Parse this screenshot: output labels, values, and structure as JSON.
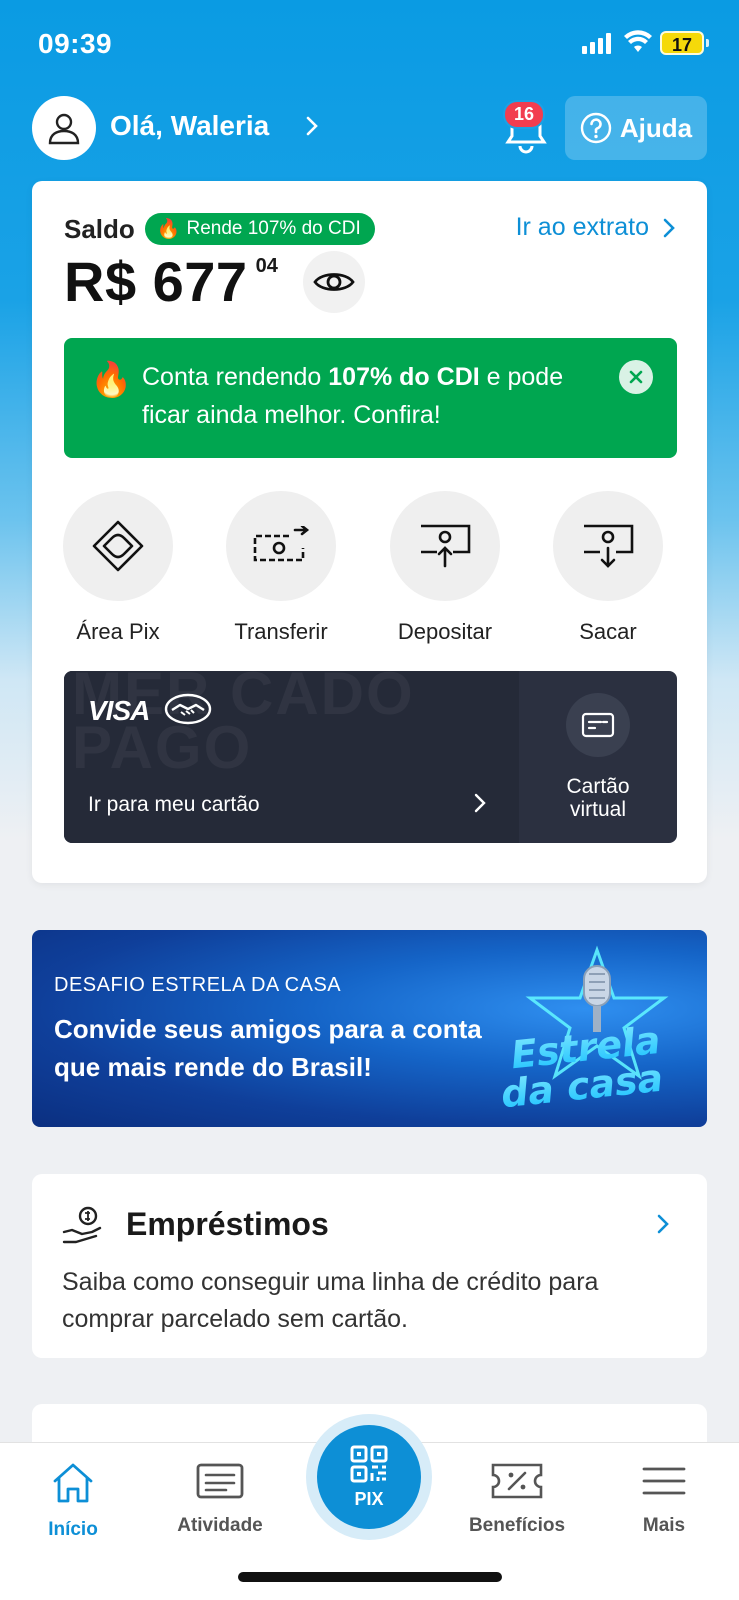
{
  "status_bar": {
    "time": "09:39",
    "battery": "17"
  },
  "header": {
    "greeting": "Olá, Waleria",
    "notification_count": "16",
    "help_label": "Ajuda"
  },
  "balance": {
    "label": "Saldo",
    "yield_badge": "Rende 107% do CDI",
    "statement_link": "Ir ao extrato",
    "amount": "R$ 677",
    "cents": "04"
  },
  "promo": {
    "text_before": "Conta rendendo ",
    "text_bold": "107% do CDI",
    "text_after": " e pode ficar ainda melhor. Confira!"
  },
  "actions": [
    {
      "label": "Área Pix",
      "icon": "pix-icon"
    },
    {
      "label": "Transferir",
      "icon": "transfer-icon"
    },
    {
      "label": "Depositar",
      "icon": "deposit-icon"
    },
    {
      "label": "Sacar",
      "icon": "withdraw-icon"
    }
  ],
  "card_section": {
    "brand": "VISA",
    "watermark": "MER CADO PAGO",
    "go_to_card": "Ir para meu cartão",
    "virtual_card": "Cartão virtual"
  },
  "banner": {
    "kicker": "DESAFIO ESTRELA DA CASA",
    "headline": "Convide seus amigos para a conta que mais rende do Brasil!",
    "logo_text_1": "Estrela",
    "logo_text_2": "da casa"
  },
  "loans": {
    "title": "Empréstimos",
    "description": "Saiba como conseguir uma linha de crédito para comprar parcelado sem cartão."
  },
  "nav": {
    "home": "Início",
    "activity": "Atividade",
    "pix": "PIX",
    "benefits": "Benefícios",
    "more": "Mais"
  },
  "colors": {
    "brand_blue": "#0d8fd6",
    "header_blue": "#1aa2e6",
    "green": "#00a650",
    "card_dark": "#252a38",
    "notification_red": "#f23d4f"
  }
}
